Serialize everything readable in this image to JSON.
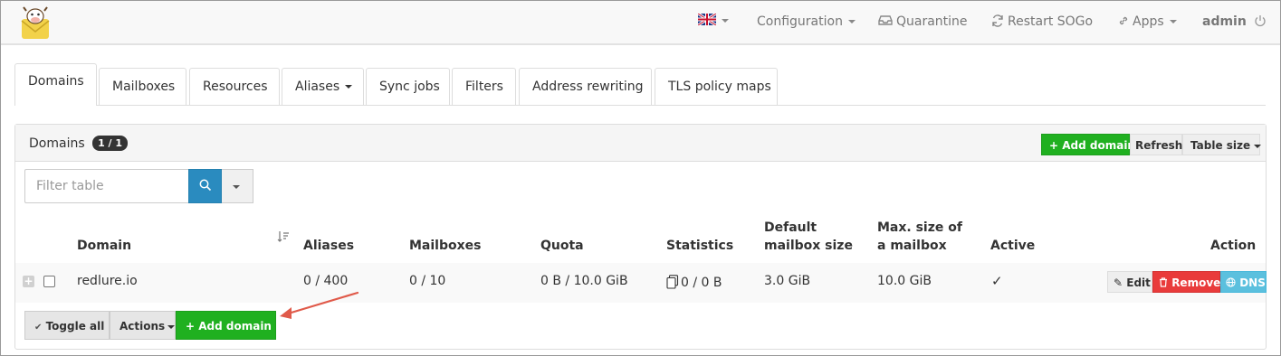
{
  "navbar": {
    "logo_icon": "mailcow-logo-icon",
    "language_icon": "uk-flag-icon",
    "configuration": "Configuration",
    "quarantine": "Quarantine",
    "restart_sogo": "Restart SOGo",
    "apps": "Apps",
    "user": "admin"
  },
  "tabs": [
    "Domains",
    "Mailboxes",
    "Resources",
    "Aliases",
    "Sync jobs",
    "Filters",
    "Address rewriting",
    "TLS policy maps"
  ],
  "panel": {
    "title": "Domains",
    "badge": "1 / 1",
    "add_domain": "Add domain",
    "refresh": "Refresh",
    "table_size": "Table size"
  },
  "filter": {
    "placeholder": "Filter table"
  },
  "table": {
    "headers": {
      "domain": "Domain",
      "aliases": "Aliases",
      "mailboxes": "Mailboxes",
      "quota": "Quota",
      "statistics": "Statistics",
      "default_size_1": "Default",
      "default_size_2": "mailbox size",
      "max_size_1": "Max. size of",
      "max_size_2": "a mailbox",
      "active": "Active",
      "action": "Action"
    },
    "rows": [
      {
        "domain": "redlure.io",
        "aliases": "0 / 400",
        "mailboxes": "0 / 10",
        "quota": "0 B / 10.0 GiB",
        "statistics": "0 / 0 B",
        "default_size": "3.0 GiB",
        "max_size": "10.0 GiB",
        "active": "✓",
        "edit": "Edit",
        "remove": "Remove",
        "dns": "DNS"
      }
    ]
  },
  "footer": {
    "toggle_all": "Toggle all",
    "actions": "Actions",
    "add_domain": "Add domain"
  },
  "colors": {
    "green": "#20b020",
    "red": "#e93b3b",
    "blue": "#5bc0de",
    "search_blue": "#2a8bbf",
    "arrow": "#e05a4a"
  }
}
